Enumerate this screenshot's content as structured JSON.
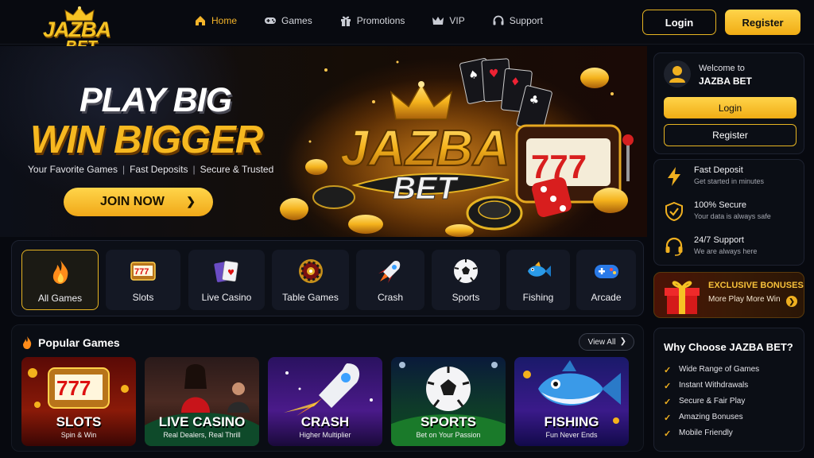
{
  "brand": {
    "logo_line1": "JAZBA",
    "logo_line2": "BET"
  },
  "nav": {
    "items": [
      {
        "label": "Home",
        "icon": "home-icon",
        "active": true
      },
      {
        "label": "Games",
        "icon": "gamepad-icon",
        "active": false
      },
      {
        "label": "Promotions",
        "icon": "gift-icon",
        "active": false
      },
      {
        "label": "VIP",
        "icon": "crown-icon",
        "active": false
      },
      {
        "label": "Support",
        "icon": "headset-icon",
        "active": false
      }
    ],
    "login_label": "Login",
    "register_label": "Register"
  },
  "hero": {
    "line1": "PLAY BIG",
    "line2": "WIN BIGGER",
    "tagline": [
      "Your Favorite Games",
      "Fast Deposits",
      "Secure & Trusted"
    ],
    "cta_label": "JOIN NOW",
    "art_logo_line1": "JAZBA",
    "art_logo_line2": "BET"
  },
  "categories": [
    {
      "label": "All Games",
      "icon": "flame-icon",
      "active": true
    },
    {
      "label": "Slots",
      "icon": "slot-machine-icon",
      "active": false
    },
    {
      "label": "Live Casino",
      "icon": "playing-cards-icon",
      "active": false
    },
    {
      "label": "Table Games",
      "icon": "roulette-icon",
      "active": false
    },
    {
      "label": "Crash",
      "icon": "rocket-icon",
      "active": false
    },
    {
      "label": "Sports",
      "icon": "soccer-ball-icon",
      "active": false
    },
    {
      "label": "Fishing",
      "icon": "fish-icon",
      "active": false
    },
    {
      "label": "Arcade",
      "icon": "arcade-controller-icon",
      "active": false
    }
  ],
  "popular": {
    "title": "Popular Games",
    "view_all_label": "View All",
    "games": [
      {
        "title": "SLOTS",
        "subtitle": "Spin & Win"
      },
      {
        "title": "LIVE CASINO",
        "subtitle": "Real Dealers, Real Thrill"
      },
      {
        "title": "CRASH",
        "subtitle": "Higher Multiplier"
      },
      {
        "title": "SPORTS",
        "subtitle": "Bet on Your Passion"
      },
      {
        "title": "FISHING",
        "subtitle": "Fun Never Ends"
      }
    ]
  },
  "sidebar": {
    "welcome_line1": "Welcome to",
    "welcome_line2": "JAZBA BET",
    "login_label": "Login",
    "register_label": "Register",
    "features": [
      {
        "title": "Fast Deposit",
        "subtitle": "Get started in minutes",
        "icon": "lightning-icon"
      },
      {
        "title": "100% Secure",
        "subtitle": "Your data is always safe",
        "icon": "shield-check-icon"
      },
      {
        "title": "24/7 Support",
        "subtitle": "We are always here",
        "icon": "headset-icon"
      }
    ],
    "bonus_title": "EXCLUSIVE BONUSES",
    "bonus_subtitle": "More Play More Win",
    "why_title": "Why Choose JAZBA BET?",
    "why_items": [
      "Wide Range of Games",
      "Instant Withdrawals",
      "Secure & Fair Play",
      "Amazing Bonuses",
      "Mobile Friendly"
    ]
  },
  "colors": {
    "accent": "#f5b52a",
    "background": "#07090f",
    "panel": "#0b0e15"
  }
}
